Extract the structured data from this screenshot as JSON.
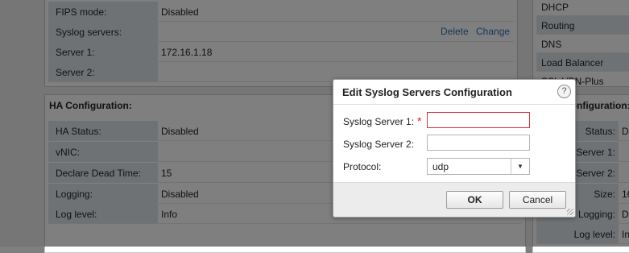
{
  "left": {
    "top_panel": {
      "rows": [
        {
          "label": "FIPS mode:",
          "value": "Disabled"
        },
        {
          "label": "Syslog servers:",
          "value": ""
        },
        {
          "label": "Server 1:",
          "value": "172.16.1.18"
        },
        {
          "label": "Server 2:",
          "value": ""
        }
      ],
      "delete_label": "Delete",
      "change_label": "Change"
    },
    "ha_panel": {
      "title": "HA Configuration:",
      "rows": [
        {
          "label": "HA Status:",
          "value": "Disabled"
        },
        {
          "label": "vNIC:",
          "value": ""
        },
        {
          "label": "Declare Dead Time:",
          "value": "15"
        },
        {
          "label": "Logging:",
          "value": "Disabled"
        },
        {
          "label": "Log level:",
          "value": "Info"
        }
      ]
    }
  },
  "right": {
    "services": [
      "DHCP",
      "Routing",
      "DNS",
      "Load Balancer",
      "SSL VPN-Plus"
    ],
    "config_title": "Configuration:",
    "rows": [
      {
        "label": "Status:",
        "value": "D"
      },
      {
        "label": "Server 1:",
        "value": ""
      },
      {
        "label": "Server 2:",
        "value": ""
      },
      {
        "label": "Size:",
        "value": "16"
      },
      {
        "label": "Logging:",
        "value": "D"
      },
      {
        "label": "Log level:",
        "value": "In"
      }
    ]
  },
  "dialog": {
    "title": "Edit Syslog Servers Configuration",
    "help": "?",
    "server1_label": "Syslog Server 1:",
    "required_mark": "*",
    "server2_label": "Syslog Server 2:",
    "protocol_label": "Protocol:",
    "protocol_value": "udp",
    "ok_label": "OK",
    "cancel_label": "Cancel"
  }
}
